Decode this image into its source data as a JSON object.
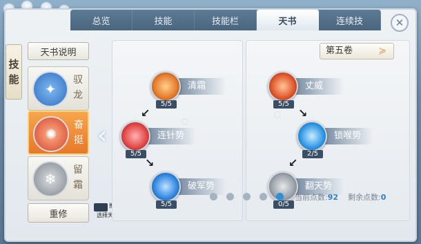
{
  "side_title": [
    "技",
    "能"
  ],
  "tabs": [
    {
      "label": "总览",
      "active": false
    },
    {
      "label": "技能",
      "active": false
    },
    {
      "label": "技能栏",
      "active": false
    },
    {
      "label": "天书",
      "active": true
    },
    {
      "label": "连续技",
      "active": false
    }
  ],
  "close_icon": "close-icon",
  "left": {
    "tianshu_label": "天书说明",
    "books": [
      {
        "name_1": "驭",
        "name_2": "龙",
        "selected": false,
        "icon": "dragon-emblem-icon",
        "color": "#3a7fd0"
      },
      {
        "name_1": "奋",
        "name_2": "挺",
        "selected": true,
        "icon": "flame-emblem-icon",
        "color": "#e4572a"
      },
      {
        "name_1": "留",
        "name_2": "霜",
        "selected": false,
        "icon": "frost-emblem-icon",
        "color": "#8b8f94"
      }
    ],
    "reset_label": "重修",
    "recommend_label_1": "推荐",
    "recommend_label_2": "选择天书"
  },
  "volume": {
    "label": "第五卷",
    "icon": "chevron-down-icon"
  },
  "tree_left": [
    {
      "name": "清霜",
      "count": "5/5",
      "color": "#e37a2b"
    },
    {
      "name": "连针势",
      "count": "5/5",
      "color": "#e24444"
    },
    {
      "name": "破军势",
      "count": "5/5",
      "color": "#2e86e0"
    }
  ],
  "tree_right": [
    {
      "name": "丈威",
      "count": "5/5",
      "color": "#e0552a"
    },
    {
      "name": "锁喉势",
      "count": "2/5",
      "color": "#2f96e4"
    },
    {
      "name": "翻天势",
      "count": "0/5",
      "color": "#9aa1a8"
    }
  ],
  "pagination": {
    "total": 5,
    "active_index": 4
  },
  "points": {
    "current_label": "当前点数:",
    "current_value": "92",
    "remaining_label": "剩余点数:",
    "remaining_value": "0"
  }
}
